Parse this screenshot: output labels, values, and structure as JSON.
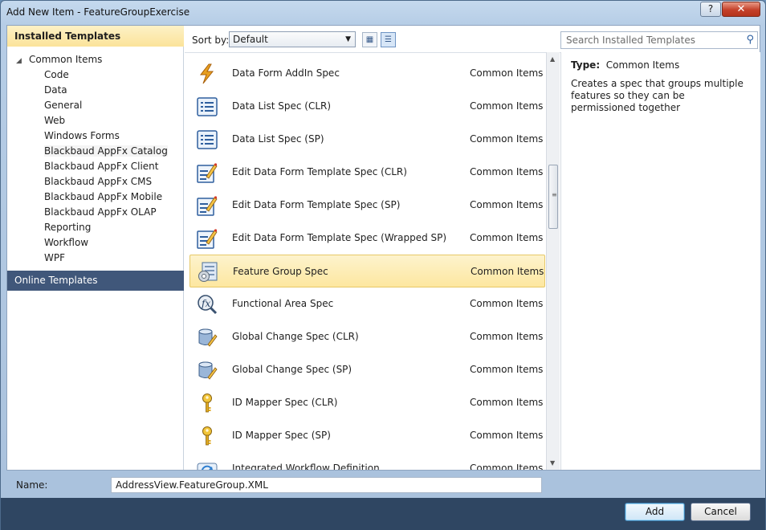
{
  "window": {
    "title": "Add New Item - FeatureGroupExercise",
    "help_label": "?",
    "close_label": "✕"
  },
  "left": {
    "installed_header": "Installed Templates",
    "root_label": "Common Items",
    "items": [
      "Code",
      "Data",
      "General",
      "Web",
      "Windows Forms",
      "Blackbaud AppFx Catalog",
      "Blackbaud AppFx Client",
      "Blackbaud AppFx CMS",
      "Blackbaud AppFx Mobile",
      "Blackbaud AppFx OLAP",
      "Reporting",
      "Workflow",
      "WPF"
    ],
    "online_header": "Online Templates"
  },
  "toolbar": {
    "sort_label": "Sort by:",
    "sort_value": "Default",
    "search_placeholder": "Search Installed Templates"
  },
  "templates": [
    {
      "name": "Data Form AddIn Spec",
      "category": "Common Items",
      "icon": "lightning-icon"
    },
    {
      "name": "Data List Spec (CLR)",
      "category": "Common Items",
      "icon": "list-icon"
    },
    {
      "name": "Data List Spec (SP)",
      "category": "Common Items",
      "icon": "list-icon"
    },
    {
      "name": "Edit Data Form Template Spec (CLR)",
      "category": "Common Items",
      "icon": "edit-form-icon"
    },
    {
      "name": "Edit Data Form Template Spec (SP)",
      "category": "Common Items",
      "icon": "edit-form-icon"
    },
    {
      "name": "Edit Data Form Template Spec (Wrapped SP)",
      "category": "Common Items",
      "icon": "edit-form-icon"
    },
    {
      "name": "Feature Group Spec",
      "category": "Common Items",
      "icon": "feature-group-icon",
      "selected": true
    },
    {
      "name": "Functional Area Spec",
      "category": "Common Items",
      "icon": "function-icon"
    },
    {
      "name": "Global Change Spec (CLR)",
      "category": "Common Items",
      "icon": "database-edit-icon"
    },
    {
      "name": "Global Change Spec (SP)",
      "category": "Common Items",
      "icon": "database-edit-icon"
    },
    {
      "name": "ID Mapper Spec (CLR)",
      "category": "Common Items",
      "icon": "key-icon"
    },
    {
      "name": "ID Mapper Spec (SP)",
      "category": "Common Items",
      "icon": "key-icon"
    },
    {
      "name": "Integrated Workflow Definition",
      "category": "Common Items",
      "icon": "workflow-icon"
    }
  ],
  "details": {
    "type_label": "Type:",
    "type_value": "Common Items",
    "description": "Creates a spec that groups multiple features so they can be permissioned together"
  },
  "footer": {
    "name_label": "Name:",
    "name_value": "AddressView.FeatureGroup.XML",
    "add_label": "Add",
    "cancel_label": "Cancel"
  }
}
